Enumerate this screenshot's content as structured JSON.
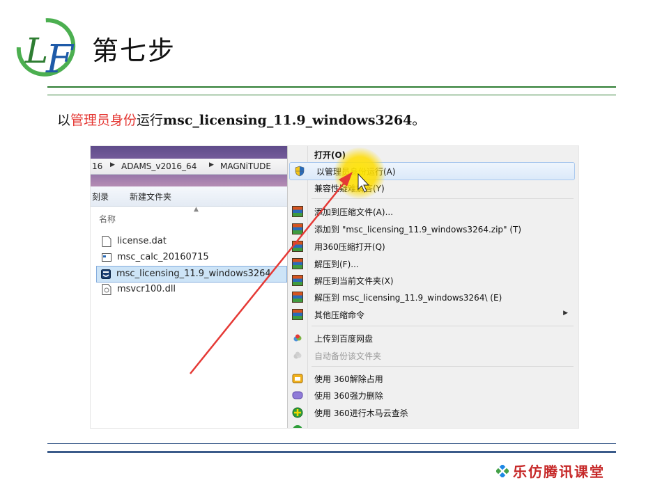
{
  "slide": {
    "title": "第七步",
    "instruction": {
      "prefix": "以",
      "highlight": "管理员身份",
      "middle": "运行",
      "filename": "msc_licensing_11.9_windows3264",
      "suffix": "。"
    },
    "footer_brand": "乐仿腾讯课堂"
  },
  "explorer": {
    "breadcrumb": [
      "16",
      "ADAMS_v2016_64",
      "MAGNiTUDE"
    ],
    "toolbar": [
      "刻录",
      "新建文件夹"
    ],
    "column_header": "名称",
    "files": [
      {
        "name": "license.dat",
        "icon": "document-icon"
      },
      {
        "name": "msc_calc_20160715",
        "icon": "app-window-icon"
      },
      {
        "name": "msc_licensing_11.9_windows3264",
        "icon": "app-icon",
        "selected": true
      },
      {
        "name": "msvcr100.dll",
        "icon": "dll-icon"
      }
    ]
  },
  "context_menu": {
    "items": [
      {
        "label": "打开(O)",
        "bold": true
      },
      {
        "label": "以管理员身份运行(A)",
        "icon": "shield-icon",
        "highlighted": true
      },
      {
        "label": "兼容性疑难解答(Y)"
      },
      {
        "label": "添加到压缩文件(A)...",
        "icon": "winrar-icon"
      },
      {
        "label": "添加到 \"msc_licensing_11.9_windows3264.zip\" (T)",
        "icon": "winrar-icon"
      },
      {
        "label": "用360压缩打开(Q)",
        "icon": "winrar-icon"
      },
      {
        "label": "解压到(F)...",
        "icon": "winrar-icon"
      },
      {
        "label": "解压到当前文件夹(X)",
        "icon": "winrar-icon"
      },
      {
        "label": "解压到 msc_licensing_11.9_windows3264\\ (E)",
        "icon": "winrar-icon"
      },
      {
        "label": "其他压缩命令",
        "icon": "winrar-icon",
        "submenu": true
      },
      {
        "label": "上传到百度网盘",
        "icon": "cloud-icon"
      },
      {
        "label": "自动备份该文件夹",
        "icon": "cloud-icon",
        "disabled": true
      },
      {
        "label": "使用 360解除占用",
        "icon": "unlock-icon"
      },
      {
        "label": "使用 360强力删除",
        "icon": "delete-icon"
      },
      {
        "label": "使用 360进行木马云查杀",
        "icon": "scan-icon"
      }
    ]
  },
  "colors": {
    "accent_red": "#e53935",
    "rule_green": "#2e7d32",
    "rule_blue": "#3b5b8a",
    "highlight_yellow": "#ffdc00"
  }
}
